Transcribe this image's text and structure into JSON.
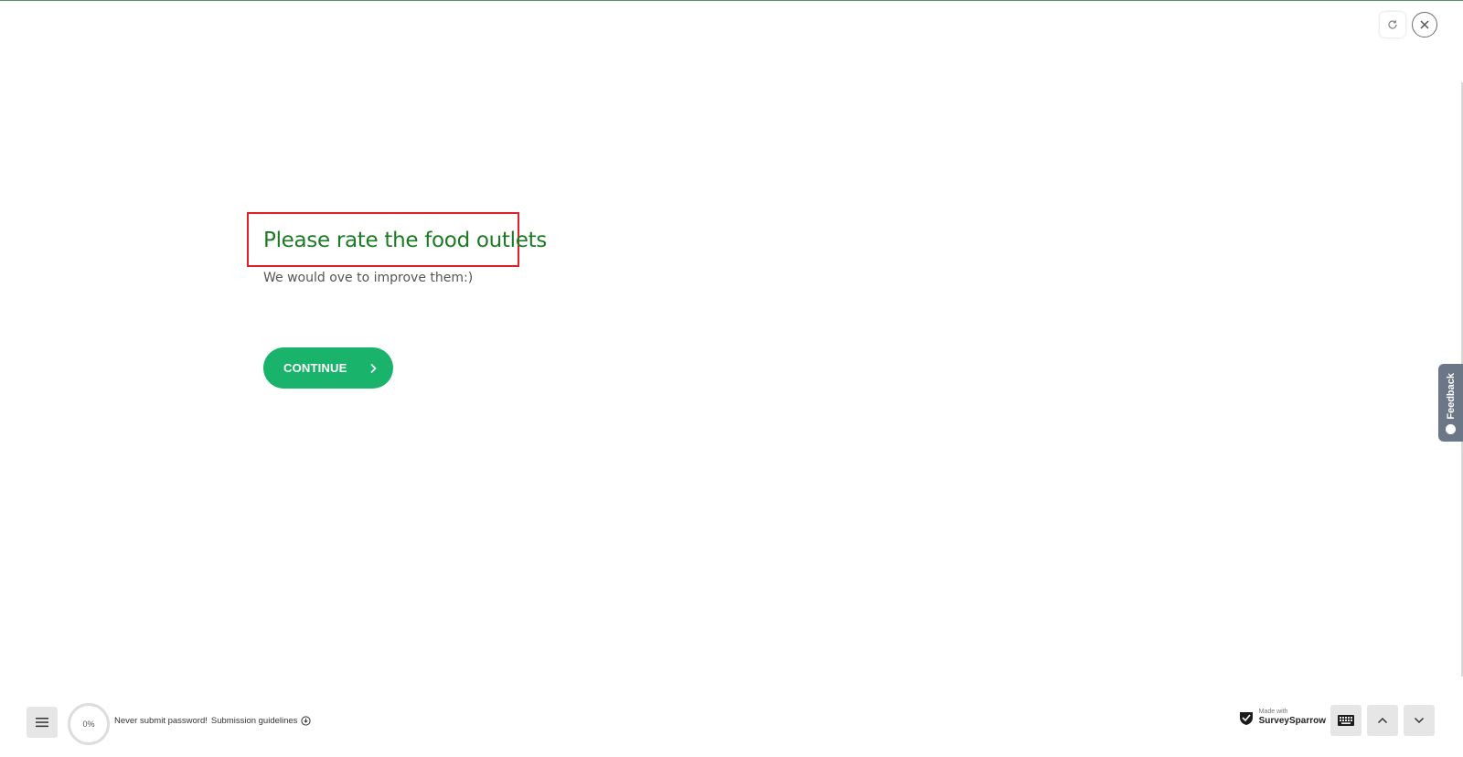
{
  "header": {
    "refresh_icon": "refresh-icon",
    "close_icon": "close-icon"
  },
  "question": {
    "title": "Please rate the food outlets",
    "subtitle": "We would ove to improve them:)"
  },
  "continue_button": {
    "label": "CONTINUE",
    "icon": "chevron-right-icon"
  },
  "feedback_tab": {
    "label": "Feedback"
  },
  "footer": {
    "progress": "0%",
    "disclaimer_text": "Never submit password!",
    "guidelines_link": "Submission guidelines",
    "branding_small": "Made with",
    "branding_name": "SurveySparrow"
  },
  "colors": {
    "accent": "#1ab36b",
    "title": "#1c7a24",
    "highlight_border": "#e11f26",
    "feedback_tab": "#6b7787"
  }
}
